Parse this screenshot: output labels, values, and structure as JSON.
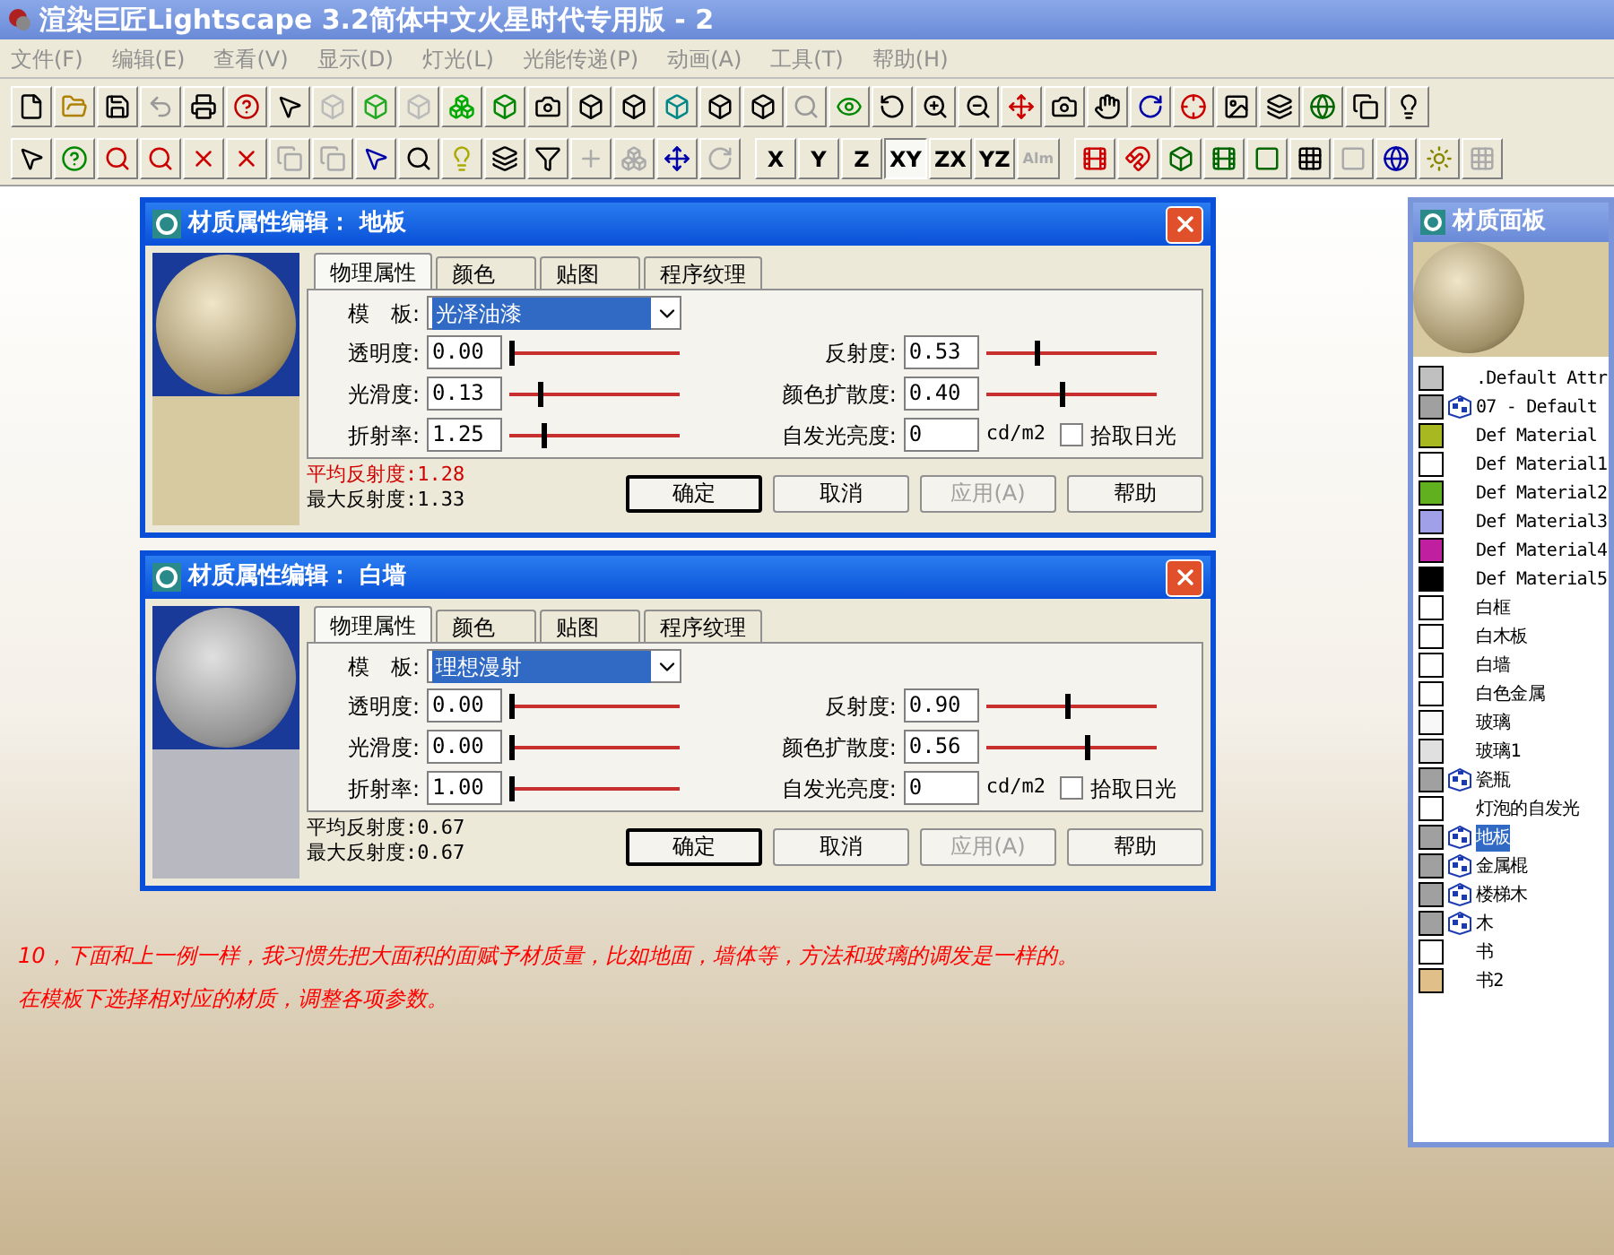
{
  "window": {
    "title": "渲染巨匠Lightscape 3.2简体中文火星时代专用版 - 2"
  },
  "menu": [
    {
      "label": "文件(F)"
    },
    {
      "label": "编辑(E)"
    },
    {
      "label": "查看(V)"
    },
    {
      "label": "显示(D)"
    },
    {
      "label": "灯光(L)"
    },
    {
      "label": "光能传递(P)"
    },
    {
      "label": "动画(A)"
    },
    {
      "label": "工具(T)"
    },
    {
      "label": "帮助(H)"
    }
  ],
  "axis_buttons": [
    {
      "label": "X",
      "selected": false,
      "disabled": false
    },
    {
      "label": "Y",
      "selected": false,
      "disabled": false
    },
    {
      "label": "Z",
      "selected": false,
      "disabled": false
    },
    {
      "label": "XY",
      "selected": true,
      "disabled": false
    },
    {
      "label": "ZX",
      "selected": false,
      "disabled": false
    },
    {
      "label": "YZ",
      "selected": false,
      "disabled": false
    },
    {
      "label": "Alm",
      "selected": false,
      "disabled": true
    }
  ],
  "dialogs": [
    {
      "title": "材质属性编辑： 地板",
      "kind": "textured",
      "tabs": [
        {
          "label": "物理属性",
          "selected": true
        },
        {
          "label": "颜色",
          "selected": false
        },
        {
          "label": "贴图",
          "selected": false
        },
        {
          "label": "程序纹理",
          "selected": false
        }
      ],
      "template_label": "模　板:",
      "template": "光泽油漆",
      "left": [
        {
          "label": "透明度:",
          "value": "0.00",
          "level": 0
        },
        {
          "label": "光滑度:",
          "value": "0.13",
          "level": 0.17
        },
        {
          "label": "折射率:",
          "value": "1.25",
          "level": 0.2
        }
      ],
      "right": [
        {
          "label": "反射度:",
          "value": "0.53",
          "level": 0.3
        },
        {
          "label": "颜色扩散度:",
          "value": "0.40",
          "level": 0.45
        }
      ],
      "emission": {
        "label": "自发光亮度:",
        "value": "0",
        "unit": "cd/m2"
      },
      "daylight": {
        "label": "拾取日光",
        "checked": false
      },
      "stats": [
        {
          "text": "平均反射度:1.28",
          "warning": true
        },
        {
          "text": "最大反射度:1.33",
          "warning": false
        }
      ],
      "buttons": [
        {
          "label": "确定",
          "default": true,
          "disabled": false
        },
        {
          "label": "取消",
          "default": false,
          "disabled": false
        },
        {
          "label": "应用(A)",
          "default": false,
          "disabled": true
        },
        {
          "label": "帮助",
          "default": false,
          "disabled": false
        }
      ]
    },
    {
      "title": "材质属性编辑： 白墙",
      "kind": "plain",
      "tabs": [
        {
          "label": "物理属性",
          "selected": true
        },
        {
          "label": "颜色",
          "selected": false
        },
        {
          "label": "贴图",
          "selected": false
        },
        {
          "label": "程序纹理",
          "selected": false
        }
      ],
      "template_label": "模　板:",
      "template": "理想漫射",
      "left": [
        {
          "label": "透明度:",
          "value": "0.00",
          "level": 0
        },
        {
          "label": "光滑度:",
          "value": "0.00",
          "level": 0
        },
        {
          "label": "折射率:",
          "value": "1.00",
          "level": 0
        }
      ],
      "right": [
        {
          "label": "反射度:",
          "value": "0.90",
          "level": 0.48
        },
        {
          "label": "颜色扩散度:",
          "value": "0.56",
          "level": 0.6
        }
      ],
      "emission": {
        "label": "自发光亮度:",
        "value": "0",
        "unit": "cd/m2"
      },
      "daylight": {
        "label": "拾取日光",
        "checked": false
      },
      "stats": [
        {
          "text": "平均反射度:0.67",
          "warning": false
        },
        {
          "text": "最大反射度:0.67",
          "warning": false
        }
      ],
      "buttons": [
        {
          "label": "确定",
          "default": true,
          "disabled": false
        },
        {
          "label": "取消",
          "default": false,
          "disabled": false
        },
        {
          "label": "应用(A)",
          "default": false,
          "disabled": true
        },
        {
          "label": "帮助",
          "default": false,
          "disabled": false
        }
      ]
    }
  ],
  "material_panel": {
    "title": "材质面板",
    "items": [
      {
        "name": ".Default Attr",
        "color": "#c0c0c0",
        "textured": false,
        "selected": false
      },
      {
        "name": "07 - Default",
        "color": "#a0a0a0",
        "textured": true,
        "selected": false
      },
      {
        "name": "Def Material",
        "color": "#a8b820",
        "textured": false,
        "selected": false
      },
      {
        "name": "Def Material1",
        "color": "#ffffff",
        "textured": false,
        "selected": false
      },
      {
        "name": "Def Material2",
        "color": "#60b020",
        "textured": false,
        "selected": false
      },
      {
        "name": "Def Material3",
        "color": "#a0a0e8",
        "textured": false,
        "selected": false
      },
      {
        "name": "Def Material4",
        "color": "#c020a0",
        "textured": false,
        "selected": false
      },
      {
        "name": "Def Material5",
        "color": "#000000",
        "textured": false,
        "selected": false
      },
      {
        "name": "白框",
        "color": "#ffffff",
        "textured": false,
        "selected": false
      },
      {
        "name": "白木板",
        "color": "#ffffff",
        "textured": false,
        "selected": false
      },
      {
        "name": "白墙",
        "color": "#ffffff",
        "textured": false,
        "selected": false
      },
      {
        "name": "白色金属",
        "color": "#ffffff",
        "textured": false,
        "selected": false
      },
      {
        "name": "玻璃",
        "color": "#f8f8f8",
        "textured": false,
        "selected": false
      },
      {
        "name": "玻璃1",
        "color": "#e0e0e0",
        "textured": false,
        "selected": false
      },
      {
        "name": "瓷瓶",
        "color": "#a0a0a0",
        "textured": true,
        "selected": false
      },
      {
        "name": "灯泡的自发光",
        "color": "#ffffff",
        "textured": false,
        "selected": false
      },
      {
        "name": "地板",
        "color": "#a0a0a0",
        "textured": true,
        "selected": true
      },
      {
        "name": "金属棍",
        "color": "#a0a0a0",
        "textured": true,
        "selected": false
      },
      {
        "name": "楼梯木",
        "color": "#a0a0a0",
        "textured": true,
        "selected": false
      },
      {
        "name": "木",
        "color": "#a0a0a0",
        "textured": true,
        "selected": false
      },
      {
        "name": "书",
        "color": "#ffffff",
        "textured": false,
        "selected": false
      },
      {
        "name": "书2",
        "color": "#e0c088",
        "textured": false,
        "selected": false
      }
    ]
  },
  "caption": [
    "10，下面和上一例一样，我习惯先把大面积的面赋予材质量，比如地面，墙体等，方法和玻璃的调发是一样的。",
    "在模板下选择相对应的材质，调整各项参数。"
  ]
}
